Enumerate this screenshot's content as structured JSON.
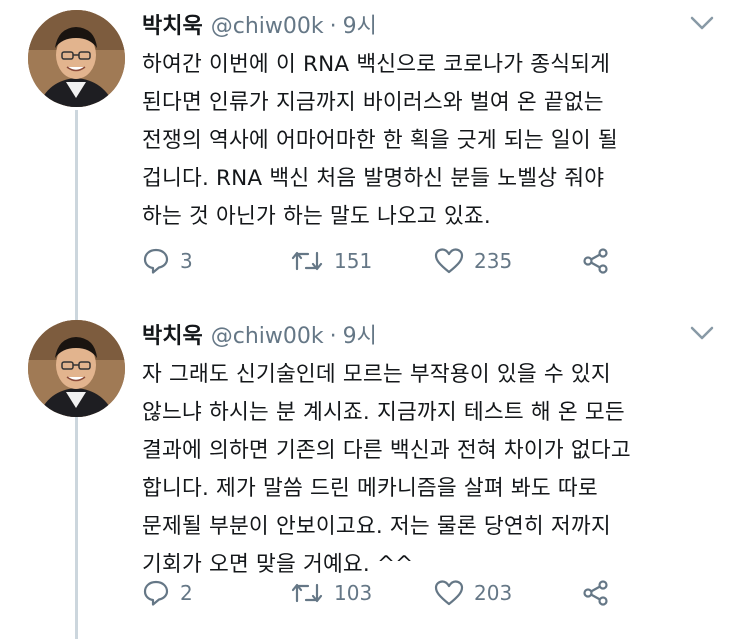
{
  "tweets": [
    {
      "name": "박치욱",
      "handle": "@chiw00k",
      "separator": "·",
      "time": "9시",
      "lines": [
        "하여간 이번에 이 RNA 백신으로 코로나가 종식되게",
        "된다면 인류가 지금까지 바이러스와 벌여 온 끝없는",
        "전쟁의 역사에 어마어마한 한 획을 긋게 되는 일이 될",
        "겁니다. RNA 백신 처음 발명하신 분들 노벨상 줘야",
        "하는 것 아닌가 하는 말도 나오고 있죠."
      ],
      "replies": "3",
      "retweets": "151",
      "likes": "235"
    },
    {
      "name": "박치욱",
      "handle": "@chiw00k",
      "separator": "·",
      "time": "9시",
      "lines": [
        "자 그래도 신기술인데 모르는 부작용이 있을 수 있지",
        "않느냐 하시는 분 계시죠. 지금까지 테스트 해 온 모든",
        "결과에 의하면 기존의 다른 백신과 전혀 차이가 없다고",
        "합니다. 제가 말씀 드린 메카니즘을 살펴 봐도 따로",
        "문제될 부분이 안보이고요. 저는 물론 당연히 저까지",
        "기회가 오면 맞을 거예요. ^^"
      ],
      "replies": "2",
      "retweets": "103",
      "likes": "203"
    }
  ],
  "icons": {
    "reply": "reply-icon",
    "retweet": "retweet-icon",
    "like": "heart-icon",
    "share": "share-icon",
    "menu": "chevron-down-icon"
  },
  "colors": {
    "text": "#14171a",
    "secondary": "#657786",
    "thread_line": "#ccd6dd"
  }
}
